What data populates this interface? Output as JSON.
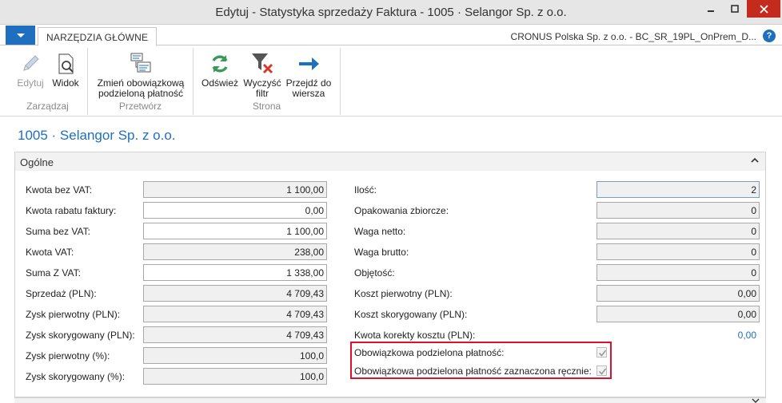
{
  "window": {
    "title": "Edytuj - Statystyka sprzedaży Faktura - 1005 · Selangor Sp. z o.o."
  },
  "ribbon": {
    "tab_home": "NARZĘDZIA GŁÓWNE",
    "company": "CRONUS Polska Sp. z o.o. - BC_SR_19PL_OnPrem_D...",
    "help": "?",
    "groups": [
      {
        "label": "Zarządzaj"
      },
      {
        "label": "Przetwórz"
      },
      {
        "label": "Strona"
      }
    ],
    "buttons": {
      "edit": "Edytuj",
      "view": "Widok",
      "change_split_line1": "Zmień obowiązkową",
      "change_split_line2": "podzieloną płatność",
      "refresh": "Odśwież",
      "clear_filter_line1": "Wyczyść",
      "clear_filter_line2": "filtr",
      "goto_line1": "Przejdź do",
      "goto_line2": "wiersza"
    }
  },
  "page": {
    "title": "1005 · Selangor Sp. z o.o."
  },
  "fasttab": {
    "title": "Ogólne"
  },
  "left_fields": [
    {
      "label": "Kwota bez VAT:",
      "value": "1 100,00",
      "editable": false
    },
    {
      "label": "Kwota rabatu faktury:",
      "value": "0,00",
      "editable": true
    },
    {
      "label": "Suma bez VAT:",
      "value": "1 100,00",
      "editable": true
    },
    {
      "label": "Kwota VAT:",
      "value": "238,00",
      "editable": false
    },
    {
      "label": "Suma Z VAT:",
      "value": "1 338,00",
      "editable": true
    },
    {
      "label": "Sprzedaż (PLN):",
      "value": "4 709,43",
      "editable": false
    },
    {
      "label": "Zysk pierwotny (PLN):",
      "value": "4 709,43",
      "editable": false
    },
    {
      "label": "Zysk skorygowany (PLN):",
      "value": "4 709,43",
      "editable": false
    },
    {
      "label": "Zysk pierwotny (%):",
      "value": "100,0",
      "editable": false
    },
    {
      "label": "Zysk skorygowany (%):",
      "value": "100,0",
      "editable": false
    }
  ],
  "right_fields": [
    {
      "label": "Ilość:",
      "value": "2",
      "editable": false
    },
    {
      "label": "Opakowania zbiorcze:",
      "value": "0",
      "editable": false
    },
    {
      "label": "Waga netto:",
      "value": "0",
      "editable": false
    },
    {
      "label": "Waga brutto:",
      "value": "0",
      "editable": false
    },
    {
      "label": "Objętość:",
      "value": "0",
      "editable": false
    },
    {
      "label": "Koszt pierwotny (PLN):",
      "value": "0,00",
      "editable": false
    },
    {
      "label": "Koszt skorygowany (PLN):",
      "value": "0,00",
      "editable": false
    },
    {
      "label": "Kwota korekty kosztu (PLN):",
      "value": "0,00",
      "editable": false
    }
  ],
  "checkboxes": [
    {
      "label": "Obowiązkowa podzielona płatność:",
      "checked": true
    },
    {
      "label": "Obowiązkowa podzielona płatność zaznaczona ręcznie:",
      "checked": true
    }
  ],
  "colors": {
    "accent": "#1e6fbf",
    "highlight": "#e0102a",
    "close_button": "#c42b1c"
  }
}
